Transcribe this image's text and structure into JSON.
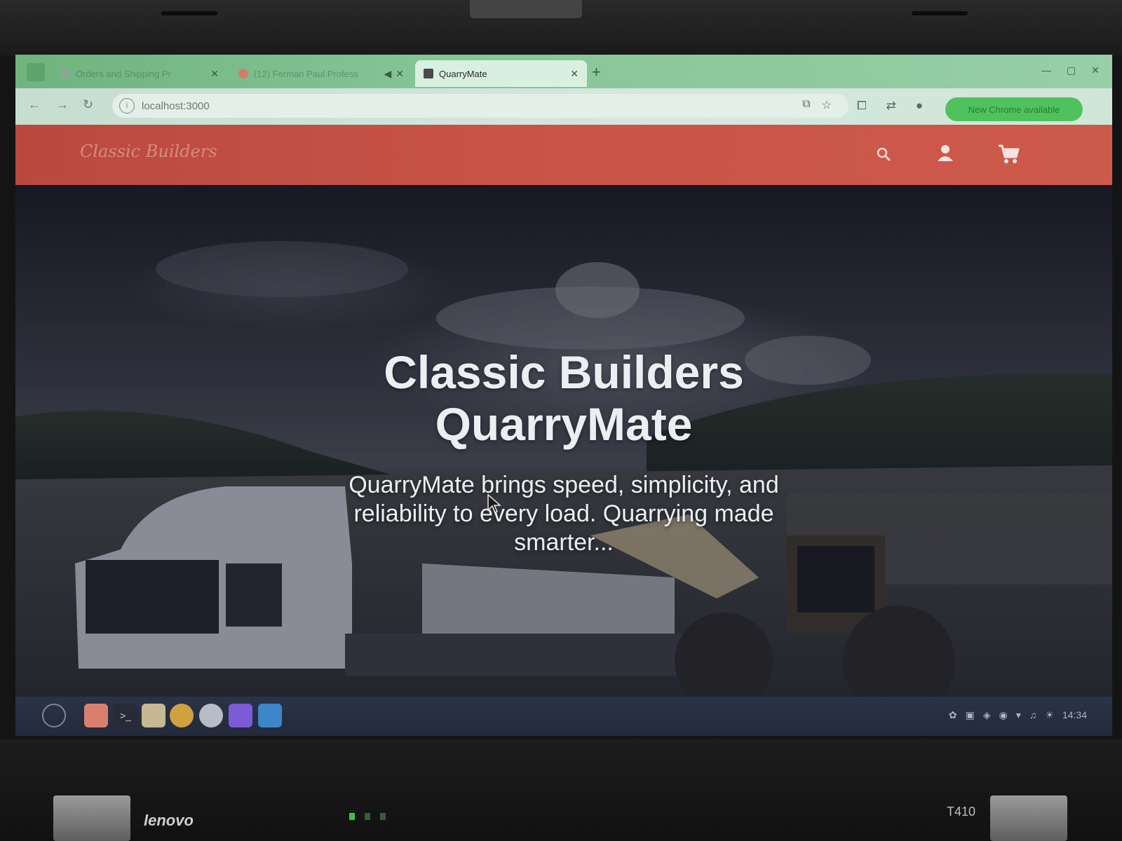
{
  "browser": {
    "tabs": [
      {
        "title": "Orders and Shipping Pr"
      },
      {
        "title": "(12) Ferman Paul Profess"
      },
      {
        "title": "QuarryMate"
      }
    ],
    "address": "localhost:3000",
    "update_button": "New Chrome available"
  },
  "site": {
    "brand": "Classic Builders"
  },
  "hero": {
    "title_line1": "Classic Builders",
    "title_line2": "QuarryMate",
    "subtitle": "QuarryMate brings speed, simplicity, and reliability to every load. Quarrying made smarter..."
  },
  "os": {
    "clock": "14:34"
  },
  "hardware": {
    "brand": "lenovo",
    "model": "T410"
  },
  "colors": {
    "navbar": "#c95547",
    "tabbar": "#86c597",
    "update_button": "#4fc25e",
    "taskbar": "#2b3346"
  }
}
